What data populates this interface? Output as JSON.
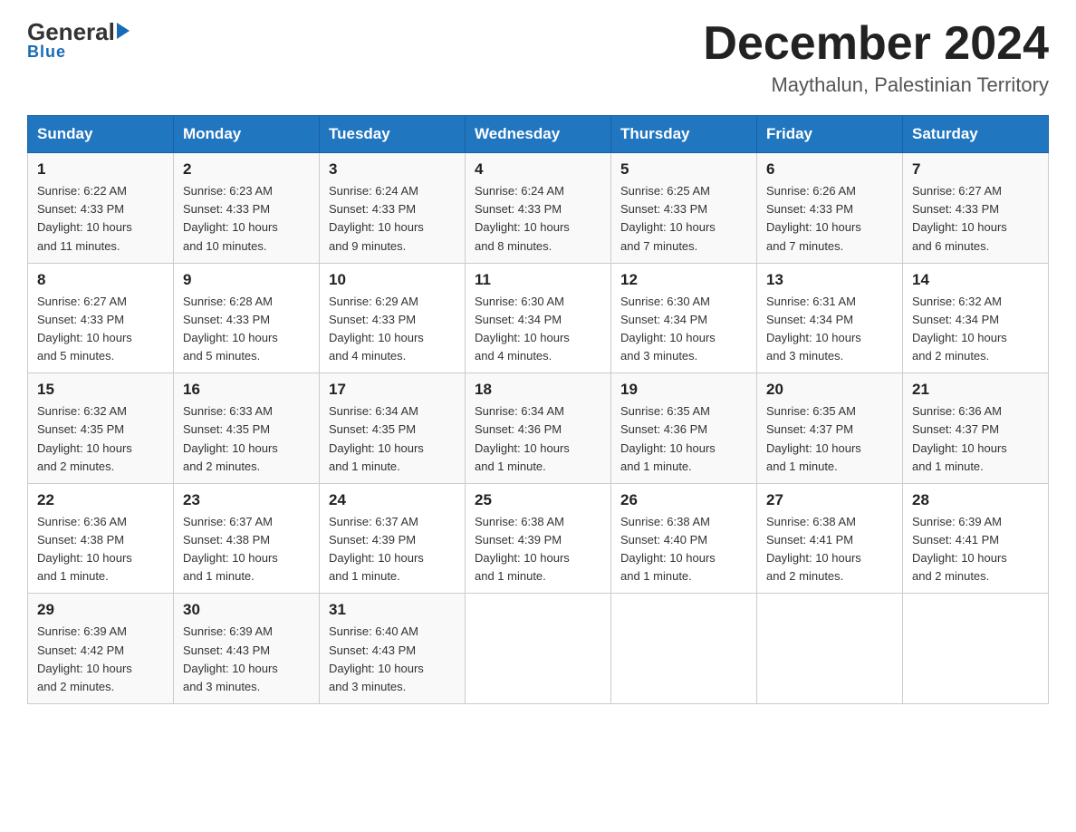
{
  "logo": {
    "general": "General",
    "blue": "Blue",
    "underline": "Blue"
  },
  "title": "December 2024",
  "subtitle": "Maythalun, Palestinian Territory",
  "headers": [
    "Sunday",
    "Monday",
    "Tuesday",
    "Wednesday",
    "Thursday",
    "Friday",
    "Saturday"
  ],
  "weeks": [
    [
      {
        "day": "1",
        "sunrise": "6:22 AM",
        "sunset": "4:33 PM",
        "daylight": "10 hours and 11 minutes."
      },
      {
        "day": "2",
        "sunrise": "6:23 AM",
        "sunset": "4:33 PM",
        "daylight": "10 hours and 10 minutes."
      },
      {
        "day": "3",
        "sunrise": "6:24 AM",
        "sunset": "4:33 PM",
        "daylight": "10 hours and 9 minutes."
      },
      {
        "day": "4",
        "sunrise": "6:24 AM",
        "sunset": "4:33 PM",
        "daylight": "10 hours and 8 minutes."
      },
      {
        "day": "5",
        "sunrise": "6:25 AM",
        "sunset": "4:33 PM",
        "daylight": "10 hours and 7 minutes."
      },
      {
        "day": "6",
        "sunrise": "6:26 AM",
        "sunset": "4:33 PM",
        "daylight": "10 hours and 7 minutes."
      },
      {
        "day": "7",
        "sunrise": "6:27 AM",
        "sunset": "4:33 PM",
        "daylight": "10 hours and 6 minutes."
      }
    ],
    [
      {
        "day": "8",
        "sunrise": "6:27 AM",
        "sunset": "4:33 PM",
        "daylight": "10 hours and 5 minutes."
      },
      {
        "day": "9",
        "sunrise": "6:28 AM",
        "sunset": "4:33 PM",
        "daylight": "10 hours and 5 minutes."
      },
      {
        "day": "10",
        "sunrise": "6:29 AM",
        "sunset": "4:33 PM",
        "daylight": "10 hours and 4 minutes."
      },
      {
        "day": "11",
        "sunrise": "6:30 AM",
        "sunset": "4:34 PM",
        "daylight": "10 hours and 4 minutes."
      },
      {
        "day": "12",
        "sunrise": "6:30 AM",
        "sunset": "4:34 PM",
        "daylight": "10 hours and 3 minutes."
      },
      {
        "day": "13",
        "sunrise": "6:31 AM",
        "sunset": "4:34 PM",
        "daylight": "10 hours and 3 minutes."
      },
      {
        "day": "14",
        "sunrise": "6:32 AM",
        "sunset": "4:34 PM",
        "daylight": "10 hours and 2 minutes."
      }
    ],
    [
      {
        "day": "15",
        "sunrise": "6:32 AM",
        "sunset": "4:35 PM",
        "daylight": "10 hours and 2 minutes."
      },
      {
        "day": "16",
        "sunrise": "6:33 AM",
        "sunset": "4:35 PM",
        "daylight": "10 hours and 2 minutes."
      },
      {
        "day": "17",
        "sunrise": "6:34 AM",
        "sunset": "4:35 PM",
        "daylight": "10 hours and 1 minute."
      },
      {
        "day": "18",
        "sunrise": "6:34 AM",
        "sunset": "4:36 PM",
        "daylight": "10 hours and 1 minute."
      },
      {
        "day": "19",
        "sunrise": "6:35 AM",
        "sunset": "4:36 PM",
        "daylight": "10 hours and 1 minute."
      },
      {
        "day": "20",
        "sunrise": "6:35 AM",
        "sunset": "4:37 PM",
        "daylight": "10 hours and 1 minute."
      },
      {
        "day": "21",
        "sunrise": "6:36 AM",
        "sunset": "4:37 PM",
        "daylight": "10 hours and 1 minute."
      }
    ],
    [
      {
        "day": "22",
        "sunrise": "6:36 AM",
        "sunset": "4:38 PM",
        "daylight": "10 hours and 1 minute."
      },
      {
        "day": "23",
        "sunrise": "6:37 AM",
        "sunset": "4:38 PM",
        "daylight": "10 hours and 1 minute."
      },
      {
        "day": "24",
        "sunrise": "6:37 AM",
        "sunset": "4:39 PM",
        "daylight": "10 hours and 1 minute."
      },
      {
        "day": "25",
        "sunrise": "6:38 AM",
        "sunset": "4:39 PM",
        "daylight": "10 hours and 1 minute."
      },
      {
        "day": "26",
        "sunrise": "6:38 AM",
        "sunset": "4:40 PM",
        "daylight": "10 hours and 1 minute."
      },
      {
        "day": "27",
        "sunrise": "6:38 AM",
        "sunset": "4:41 PM",
        "daylight": "10 hours and 2 minutes."
      },
      {
        "day": "28",
        "sunrise": "6:39 AM",
        "sunset": "4:41 PM",
        "daylight": "10 hours and 2 minutes."
      }
    ],
    [
      {
        "day": "29",
        "sunrise": "6:39 AM",
        "sunset": "4:42 PM",
        "daylight": "10 hours and 2 minutes."
      },
      {
        "day": "30",
        "sunrise": "6:39 AM",
        "sunset": "4:43 PM",
        "daylight": "10 hours and 3 minutes."
      },
      {
        "day": "31",
        "sunrise": "6:40 AM",
        "sunset": "4:43 PM",
        "daylight": "10 hours and 3 minutes."
      },
      null,
      null,
      null,
      null
    ]
  ],
  "cell_labels": {
    "sunrise": "Sunrise: ",
    "sunset": "Sunset: ",
    "daylight": "Daylight: "
  }
}
